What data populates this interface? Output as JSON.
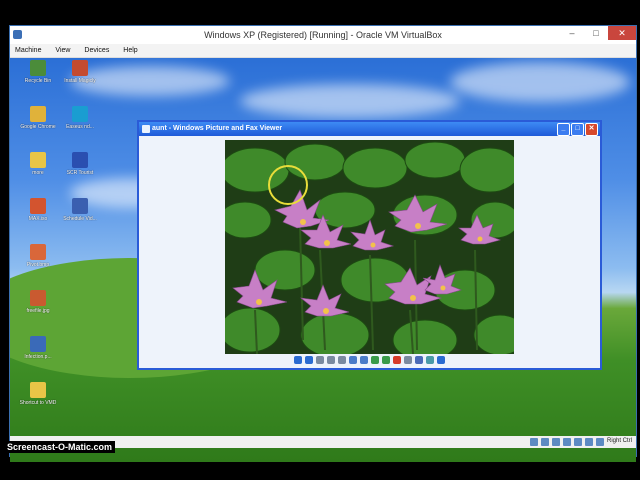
{
  "host": {
    "title": "Windows XP (Registered) [Running] - Oracle VM VirtualBox",
    "menu": [
      "Machine",
      "View",
      "Devices",
      "Help"
    ],
    "window_controls": {
      "minimize": "–",
      "maximize": "□",
      "close": "✕"
    },
    "status_right": "Right Ctrl"
  },
  "desktop": {
    "icons": [
      {
        "label": "Recycle Bin",
        "color": "#4b8c3a"
      },
      {
        "label": "Install Magicly",
        "color": "#c44b2f"
      },
      {
        "label": "Google Chrome",
        "color": "#e0b23a"
      },
      {
        "label": "Easeus nd...",
        "color": "#1a9dd1"
      },
      {
        "label": "more",
        "color": "#e8c547"
      },
      {
        "label": "SCR Tourist",
        "color": "#2a4fb0"
      },
      {
        "label": "MAX.iso",
        "color": "#d3542f"
      },
      {
        "label": "Schedule Vid...",
        "color": "#3a5fb0"
      },
      {
        "label": "Pivot.bmp",
        "color": "#d9673a"
      },
      {
        "label": "freefile.jpg",
        "color": "#c95a30"
      },
      {
        "label": "Infection.p...",
        "color": "#3a6ab8"
      },
      {
        "label": "Shortcut to VMD",
        "color": "#e8c547"
      }
    ]
  },
  "viewer": {
    "title": "aunt - Windows Picture and Fax Viewer",
    "window_controls": {
      "minimize": "_",
      "maximize": "□",
      "close": "✕"
    },
    "toolbar": [
      {
        "name": "previous-image-icon",
        "color": "#2a6bd1"
      },
      {
        "name": "next-image-icon",
        "color": "#2a6bd1"
      },
      {
        "name": "best-fit-icon",
        "color": "#7a8aa0"
      },
      {
        "name": "actual-size-icon",
        "color": "#7a8aa0"
      },
      {
        "name": "slideshow-icon",
        "color": "#7a8aa0"
      },
      {
        "name": "zoom-in-icon",
        "color": "#4a7bc8"
      },
      {
        "name": "zoom-out-icon",
        "color": "#4a7bc8"
      },
      {
        "name": "rotate-clockwise-icon",
        "color": "#3a9a4a"
      },
      {
        "name": "rotate-counterclockwise-icon",
        "color": "#3a9a4a"
      },
      {
        "name": "delete-icon",
        "color": "#d63a2a"
      },
      {
        "name": "print-icon",
        "color": "#7a8aa0"
      },
      {
        "name": "copy-to-icon",
        "color": "#4a6ab8"
      },
      {
        "name": "edit-icon",
        "color": "#4a9aa8"
      },
      {
        "name": "help-icon",
        "color": "#2a6bd1"
      }
    ]
  },
  "overlay": {
    "watermark": "Screencast-O-Matic.com"
  },
  "colors": {
    "xp_titlebar": "#1f5ad8",
    "close_red": "#c9463d",
    "desktop_grass": "#3f8f26"
  }
}
